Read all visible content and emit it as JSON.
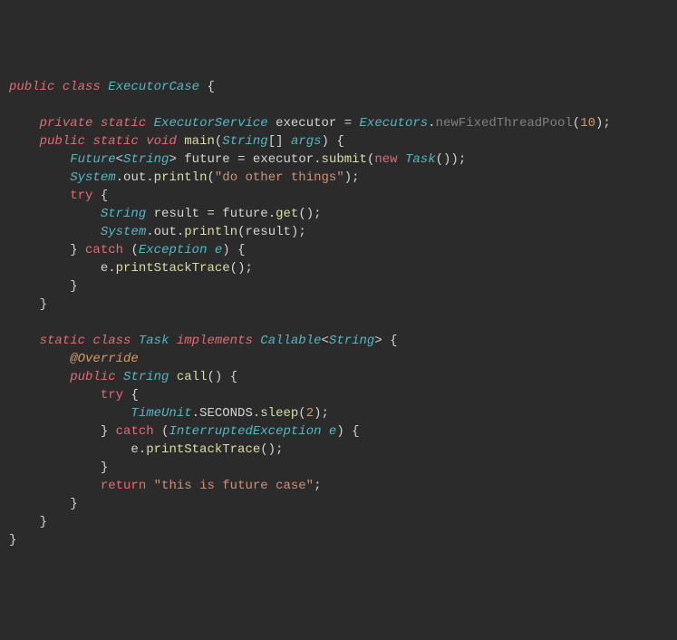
{
  "code": {
    "lines": [
      {
        "indent": 0,
        "tokens": [
          {
            "t": "public",
            "c": "kw-mod"
          },
          {
            "t": " "
          },
          {
            "t": "class",
            "c": "kw-mod"
          },
          {
            "t": " "
          },
          {
            "t": "ExecutorCase",
            "c": "type"
          },
          {
            "t": " "
          },
          {
            "t": "{",
            "c": "brace"
          }
        ]
      },
      {
        "indent": 0,
        "tokens": []
      },
      {
        "indent": 1,
        "tokens": [
          {
            "t": "private",
            "c": "kw-mod"
          },
          {
            "t": " "
          },
          {
            "t": "static",
            "c": "kw-mod"
          },
          {
            "t": " "
          },
          {
            "t": "ExecutorService",
            "c": "type"
          },
          {
            "t": " "
          },
          {
            "t": "executor",
            "c": "var"
          },
          {
            "t": " = ",
            "c": "op"
          },
          {
            "t": "Executors",
            "c": "type"
          },
          {
            "t": ".",
            "c": "dot"
          },
          {
            "t": "newFixedThreadPool",
            "c": "method-dim"
          },
          {
            "t": "(",
            "c": "punct"
          },
          {
            "t": "10",
            "c": "num"
          },
          {
            "t": ")",
            "c": "punct"
          },
          {
            "t": ";",
            "c": "punct"
          }
        ]
      },
      {
        "indent": 1,
        "tokens": [
          {
            "t": "public",
            "c": "kw-mod"
          },
          {
            "t": " "
          },
          {
            "t": "static",
            "c": "kw-mod"
          },
          {
            "t": " "
          },
          {
            "t": "void",
            "c": "kw-ret"
          },
          {
            "t": " "
          },
          {
            "t": "main",
            "c": "method"
          },
          {
            "t": "(",
            "c": "punct"
          },
          {
            "t": "String",
            "c": "type"
          },
          {
            "t": "[]",
            "c": "punct"
          },
          {
            "t": " "
          },
          {
            "t": "args",
            "c": "param"
          },
          {
            "t": ")",
            "c": "punct"
          },
          {
            "t": " "
          },
          {
            "t": "{",
            "c": "brace"
          }
        ]
      },
      {
        "indent": 2,
        "tokens": [
          {
            "t": "Future",
            "c": "type"
          },
          {
            "t": "<",
            "c": "punct"
          },
          {
            "t": "String",
            "c": "type"
          },
          {
            "t": ">",
            "c": "punct"
          },
          {
            "t": " "
          },
          {
            "t": "future",
            "c": "var"
          },
          {
            "t": " = ",
            "c": "op"
          },
          {
            "t": "executor",
            "c": "var"
          },
          {
            "t": ".",
            "c": "dot"
          },
          {
            "t": "submit",
            "c": "method"
          },
          {
            "t": "(",
            "c": "punct"
          },
          {
            "t": "new",
            "c": "kw"
          },
          {
            "t": " "
          },
          {
            "t": "Task",
            "c": "type"
          },
          {
            "t": "()",
            "c": "punct"
          },
          {
            "t": ")",
            "c": "punct"
          },
          {
            "t": ";",
            "c": "punct"
          }
        ]
      },
      {
        "indent": 2,
        "tokens": [
          {
            "t": "System",
            "c": "type"
          },
          {
            "t": ".",
            "c": "dot"
          },
          {
            "t": "out",
            "c": "var"
          },
          {
            "t": ".",
            "c": "dot"
          },
          {
            "t": "println",
            "c": "method"
          },
          {
            "t": "(",
            "c": "punct"
          },
          {
            "t": "\"do other things\"",
            "c": "str"
          },
          {
            "t": ")",
            "c": "punct"
          },
          {
            "t": ";",
            "c": "punct"
          }
        ]
      },
      {
        "indent": 2,
        "tokens": [
          {
            "t": "try",
            "c": "kw"
          },
          {
            "t": " "
          },
          {
            "t": "{",
            "c": "brace"
          }
        ]
      },
      {
        "indent": 3,
        "tokens": [
          {
            "t": "String",
            "c": "type"
          },
          {
            "t": " "
          },
          {
            "t": "result",
            "c": "var"
          },
          {
            "t": " = ",
            "c": "op"
          },
          {
            "t": "future",
            "c": "var"
          },
          {
            "t": ".",
            "c": "dot"
          },
          {
            "t": "get",
            "c": "method"
          },
          {
            "t": "()",
            "c": "punct"
          },
          {
            "t": ";",
            "c": "punct"
          }
        ]
      },
      {
        "indent": 3,
        "tokens": [
          {
            "t": "System",
            "c": "type"
          },
          {
            "t": ".",
            "c": "dot"
          },
          {
            "t": "out",
            "c": "var"
          },
          {
            "t": ".",
            "c": "dot"
          },
          {
            "t": "println",
            "c": "method"
          },
          {
            "t": "(",
            "c": "punct"
          },
          {
            "t": "result",
            "c": "var"
          },
          {
            "t": ")",
            "c": "punct"
          },
          {
            "t": ";",
            "c": "punct"
          }
        ]
      },
      {
        "indent": 2,
        "tokens": [
          {
            "t": "}",
            "c": "brace"
          },
          {
            "t": " "
          },
          {
            "t": "catch",
            "c": "kw"
          },
          {
            "t": " "
          },
          {
            "t": "(",
            "c": "punct"
          },
          {
            "t": "Exception",
            "c": "type"
          },
          {
            "t": " "
          },
          {
            "t": "e",
            "c": "param"
          },
          {
            "t": ")",
            "c": "punct"
          },
          {
            "t": " "
          },
          {
            "t": "{",
            "c": "brace"
          }
        ]
      },
      {
        "indent": 3,
        "tokens": [
          {
            "t": "e",
            "c": "var"
          },
          {
            "t": ".",
            "c": "dot"
          },
          {
            "t": "printStackTrace",
            "c": "method"
          },
          {
            "t": "()",
            "c": "punct"
          },
          {
            "t": ";",
            "c": "punct"
          }
        ]
      },
      {
        "indent": 2,
        "tokens": [
          {
            "t": "}",
            "c": "brace"
          }
        ]
      },
      {
        "indent": 1,
        "tokens": [
          {
            "t": "}",
            "c": "brace"
          }
        ]
      },
      {
        "indent": 0,
        "tokens": []
      },
      {
        "indent": 1,
        "tokens": [
          {
            "t": "static",
            "c": "kw-mod"
          },
          {
            "t": " "
          },
          {
            "t": "class",
            "c": "kw-mod"
          },
          {
            "t": " "
          },
          {
            "t": "Task",
            "c": "type"
          },
          {
            "t": " "
          },
          {
            "t": "implements",
            "c": "kw-mod"
          },
          {
            "t": " "
          },
          {
            "t": "Callable",
            "c": "type"
          },
          {
            "t": "<",
            "c": "punct"
          },
          {
            "t": "String",
            "c": "type"
          },
          {
            "t": ">",
            "c": "punct"
          },
          {
            "t": " "
          },
          {
            "t": "{",
            "c": "brace"
          }
        ]
      },
      {
        "indent": 2,
        "tokens": [
          {
            "t": "@Override",
            "c": "annot"
          }
        ]
      },
      {
        "indent": 2,
        "tokens": [
          {
            "t": "public",
            "c": "kw-mod"
          },
          {
            "t": " "
          },
          {
            "t": "String",
            "c": "type"
          },
          {
            "t": " "
          },
          {
            "t": "call",
            "c": "method"
          },
          {
            "t": "()",
            "c": "punct"
          },
          {
            "t": " "
          },
          {
            "t": "{",
            "c": "brace"
          }
        ]
      },
      {
        "indent": 3,
        "tokens": [
          {
            "t": "try",
            "c": "kw"
          },
          {
            "t": " "
          },
          {
            "t": "{",
            "c": "brace"
          }
        ]
      },
      {
        "indent": 4,
        "tokens": [
          {
            "t": "TimeUnit",
            "c": "type"
          },
          {
            "t": ".",
            "c": "dot"
          },
          {
            "t": "SECONDS",
            "c": "var"
          },
          {
            "t": ".",
            "c": "dot"
          },
          {
            "t": "sleep",
            "c": "method"
          },
          {
            "t": "(",
            "c": "punct"
          },
          {
            "t": "2",
            "c": "num"
          },
          {
            "t": ")",
            "c": "punct"
          },
          {
            "t": ";",
            "c": "punct"
          }
        ]
      },
      {
        "indent": 3,
        "tokens": [
          {
            "t": "}",
            "c": "brace"
          },
          {
            "t": " "
          },
          {
            "t": "catch",
            "c": "kw"
          },
          {
            "t": " "
          },
          {
            "t": "(",
            "c": "punct"
          },
          {
            "t": "InterruptedException",
            "c": "type"
          },
          {
            "t": " "
          },
          {
            "t": "e",
            "c": "param"
          },
          {
            "t": ")",
            "c": "punct"
          },
          {
            "t": " "
          },
          {
            "t": "{",
            "c": "brace"
          }
        ]
      },
      {
        "indent": 4,
        "tokens": [
          {
            "t": "e",
            "c": "var"
          },
          {
            "t": ".",
            "c": "dot"
          },
          {
            "t": "printStackTrace",
            "c": "method"
          },
          {
            "t": "()",
            "c": "punct"
          },
          {
            "t": ";",
            "c": "punct"
          }
        ]
      },
      {
        "indent": 3,
        "tokens": [
          {
            "t": "}",
            "c": "brace"
          }
        ]
      },
      {
        "indent": 3,
        "tokens": [
          {
            "t": "return",
            "c": "kw"
          },
          {
            "t": " "
          },
          {
            "t": "\"this is future case\"",
            "c": "str"
          },
          {
            "t": ";",
            "c": "punct"
          }
        ]
      },
      {
        "indent": 2,
        "tokens": [
          {
            "t": "}",
            "c": "brace"
          }
        ]
      },
      {
        "indent": 1,
        "tokens": [
          {
            "t": "}",
            "c": "brace"
          }
        ]
      },
      {
        "indent": 0,
        "tokens": [
          {
            "t": "}",
            "c": "brace"
          }
        ]
      }
    ]
  },
  "indent_unit": "    "
}
